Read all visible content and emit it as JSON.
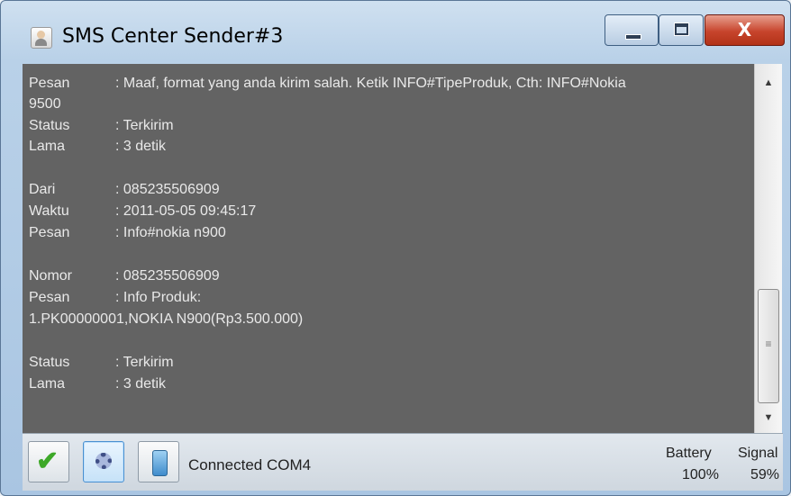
{
  "window": {
    "title": "SMS Center Sender#3",
    "close_glyph": "X"
  },
  "log": [
    {
      "key": "Pesan",
      "value": ": Maaf, format yang anda kirim salah. Ketik INFO#TipeProduk, Cth: INFO#Nokia"
    },
    {
      "key": "",
      "value": "9500",
      "full": true
    },
    {
      "key": "Status",
      "value": ": Terkirim"
    },
    {
      "key": "Lama",
      "value": ": 3 detik"
    },
    {
      "key": "Dari",
      "value": ": 085235506909"
    },
    {
      "key": "Waktu",
      "value": ": 2011-05-05 09:45:17"
    },
    {
      "key": "Pesan",
      "value": ": Info#nokia n900"
    },
    {
      "key": "Nomor",
      "value": ": 085235506909"
    },
    {
      "key": "Pesan",
      "value": ": Info Produk:"
    },
    {
      "key": "",
      "value": "1.PK00000001,NOKIA N900(Rp3.500.000)",
      "full": true
    },
    {
      "key": "Status",
      "value": ": Terkirim"
    },
    {
      "key": "Lama",
      "value": ": 3 detik"
    }
  ],
  "statusbar": {
    "connection": "Connected COM4",
    "battery_label": "Battery",
    "battery_value": "100%",
    "signal_label": "Signal",
    "signal_value": "59%"
  },
  "icons": {
    "ok": "check-icon",
    "settings": "gear-icon",
    "phone": "phone-icon"
  },
  "colors": {
    "log_background": "#636363",
    "log_text": "#e9e9e9",
    "close_button": "#c7442c"
  }
}
